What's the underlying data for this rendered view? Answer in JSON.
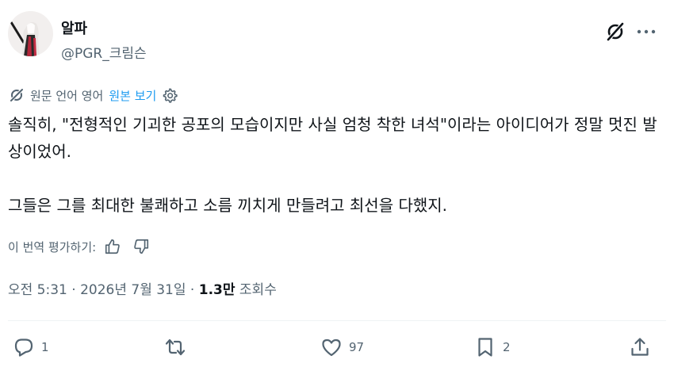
{
  "user": {
    "display_name": "알파",
    "handle": "@PGR_크림슨"
  },
  "header": {
    "grok_icon": "grok-icon",
    "more_icon": "more-horizontal-icon"
  },
  "translation": {
    "status": "원문 언어 영어",
    "view_original": "원본 보기",
    "icon": "translate-icon",
    "settings_icon": "gear-icon"
  },
  "tweet": {
    "paragraph1": "솔직히, \"전형적인 기괴한 공포의 모습이지만 사실 엄청 착한 녀석\"이라는 아이디어가 정말 멋진 발상이었어.",
    "paragraph2": "그들은 그를 최대한 불쾌하고 소름 끼치게 만들려고 최선을 다했지."
  },
  "rating": {
    "label": "이 번역 평가하기:",
    "up_icon": "thumbs-up-icon",
    "down_icon": "thumbs-down-icon"
  },
  "meta": {
    "time": "오전 5:31",
    "separator1": " · ",
    "date": "2026년 7월 31일",
    "separator2": " · ",
    "views_count": "1.3만",
    "views_label": " 조회수"
  },
  "actions": {
    "reply_count": "1",
    "retweet_count": "",
    "like_count": "97",
    "bookmark_count": "2"
  },
  "colors": {
    "text_primary": "#0f1419",
    "text_secondary": "#536471",
    "link": "#1d9bf0",
    "divider": "#eff3f4"
  }
}
